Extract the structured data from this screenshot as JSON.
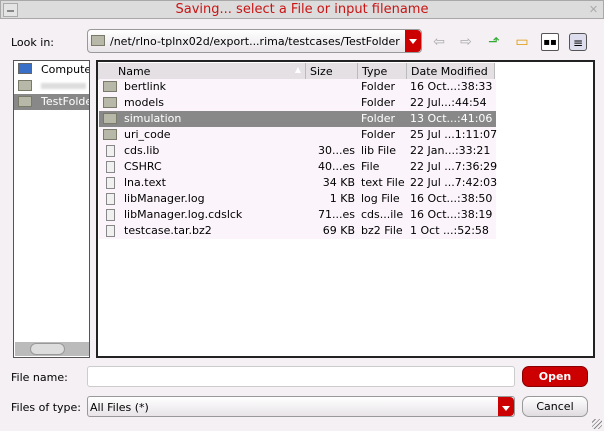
{
  "window": {
    "title": "Saving... select a File or input filename"
  },
  "lookin": {
    "label": "Look in:",
    "path": "/net/rlno-tplnx02d/export...rima/testcases/TestFolder"
  },
  "toolbar": [
    "back-icon",
    "forward-icon",
    "up-folder-icon",
    "new-folder-icon",
    "icon-view-icon",
    "list-view-icon"
  ],
  "sidebar": {
    "items": [
      {
        "label": "Compute",
        "icon": "computer-icon"
      },
      {
        "label": "",
        "icon": "home-folder-icon"
      },
      {
        "label": "TestFolde",
        "icon": "folder-icon",
        "selected": true
      }
    ]
  },
  "list": {
    "columns": [
      "Name",
      "Size",
      "Type",
      "Date Modified"
    ],
    "rows": [
      {
        "name": "bertlink",
        "size": "",
        "type": "Folder",
        "date": "16 Oct...:38:33",
        "folder": true
      },
      {
        "name": "models",
        "size": "",
        "type": "Folder",
        "date": "22 Jul...:44:54",
        "folder": true
      },
      {
        "name": "simulation",
        "size": "",
        "type": "Folder",
        "date": "13 Oct...:41:06",
        "folder": true,
        "selected": true
      },
      {
        "name": "uri_code",
        "size": "",
        "type": "Folder",
        "date": "25 Jul ...1:11:07",
        "folder": true
      },
      {
        "name": "cds.lib",
        "size": "30...es",
        "type": "lib File",
        "date": "22 Jan...:33:21"
      },
      {
        "name": "CSHRC",
        "size": "40...es",
        "type": "File",
        "date": "22 Jul ...7:36:29"
      },
      {
        "name": "lna.text",
        "size": "34 KB",
        "type": "text File",
        "date": "22 Jul ...7:42:03"
      },
      {
        "name": "libManager.log",
        "size": "1 KB",
        "type": "log File",
        "date": "16 Oct...:38:50"
      },
      {
        "name": "libManager.log.cdslck",
        "size": "71...es",
        "type": "cds...ile",
        "date": "16 Oct...:38:19"
      },
      {
        "name": "testcase.tar.bz2",
        "size": "69 KB",
        "type": "bz2 File",
        "date": "1 Oct ...:52:58"
      }
    ]
  },
  "filename": {
    "label": "File name:",
    "value": ""
  },
  "filetype": {
    "label": "Files of type:",
    "value": "All Files (*)"
  },
  "buttons": {
    "open": "Open",
    "cancel": "Cancel"
  }
}
